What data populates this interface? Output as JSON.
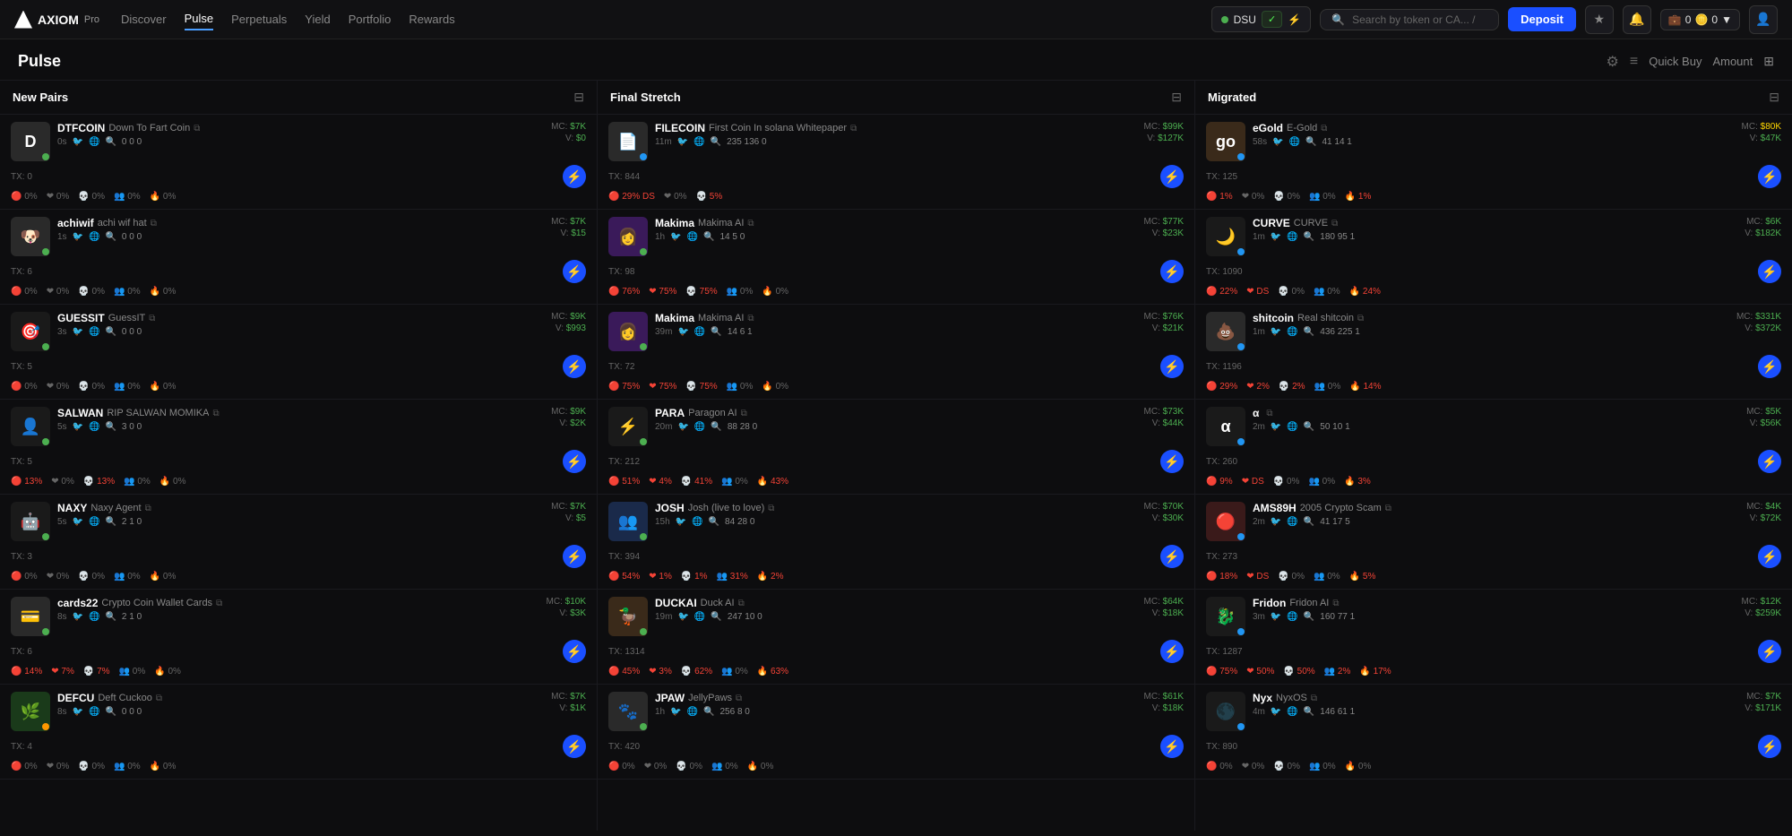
{
  "nav": {
    "logo": "AXIOM",
    "logo_sub": "Pro",
    "links": [
      "Discover",
      "Pulse",
      "Perpetuals",
      "Yield",
      "Portfolio",
      "Rewards"
    ],
    "active_link": "Pulse",
    "wallet": "DSU",
    "search_placeholder": "Search by token or CA... /",
    "deposit_label": "Deposit",
    "balance1": "0",
    "balance2": "0"
  },
  "page": {
    "title": "Pulse",
    "quick_buy": "Quick Buy",
    "amount": "Amount"
  },
  "columns": [
    {
      "id": "new-pairs",
      "title": "New Pairs",
      "cards": [
        {
          "symbol": "DTFCOIN",
          "name": "Down To Fart Coin",
          "bg": "D",
          "bg_color": "bg-gray",
          "age": "0s",
          "icon_links": true,
          "counts": "0 0 0",
          "mc": "$7K",
          "volume": "$0",
          "tx": "0",
          "pcts": [
            "0%",
            "0%",
            "0%",
            "0%",
            "0%"
          ],
          "status": "green"
        },
        {
          "symbol": "achiwif",
          "name": "achi wif hat",
          "bg": "🐶",
          "bg_color": "bg-gray",
          "age": "1s",
          "counts": "0 0 0",
          "mc": "$7K",
          "volume": "$15",
          "tx": "6",
          "pcts": [
            "0%",
            "0%",
            "0%",
            "0%",
            "0%"
          ],
          "status": "green"
        },
        {
          "symbol": "GUESSIT",
          "name": "GuessIT",
          "bg": "🎯",
          "bg_color": "bg-dark",
          "age": "3s",
          "counts": "0 0 0",
          "mc": "$9K",
          "volume": "$993",
          "tx": "5",
          "pcts": [
            "0%",
            "0%",
            "0%",
            "0%",
            "0%"
          ],
          "status": "green"
        },
        {
          "symbol": "SALWAN",
          "name": "RIP SALWAN MOMIKA",
          "bg": "👤",
          "bg_color": "bg-dark",
          "age": "5s",
          "counts": "3 0 0",
          "mc": "$9K",
          "volume": "$2K",
          "tx": "5",
          "pcts": [
            "13%",
            "0%",
            "13%",
            "0%",
            "0%"
          ],
          "status": "green"
        },
        {
          "symbol": "NAXY",
          "name": "Naxy Agent",
          "bg": "🤖",
          "bg_color": "bg-dark",
          "age": "5s",
          "counts": "2 1 0",
          "mc": "$7K",
          "volume": "$5",
          "tx": "3",
          "pcts": [
            "0%",
            "0%",
            "0%",
            "0%",
            "0%"
          ],
          "status": "green"
        },
        {
          "symbol": "cards22",
          "name": "Crypto Coin Wallet Cards",
          "bg": "💳",
          "bg_color": "bg-gray",
          "age": "8s",
          "counts": "2 1 0",
          "mc": "$10K",
          "volume": "$3K",
          "tx": "6",
          "pcts": [
            "14%",
            "7%",
            "7%",
            "0%",
            "0%"
          ],
          "status": "green"
        },
        {
          "symbol": "DEFCU",
          "name": "Deft Cuckoo",
          "bg": "🌿",
          "bg_color": "bg-green",
          "age": "8s",
          "counts": "0 0 0",
          "mc": "$7K",
          "volume": "$1K",
          "tx": "4",
          "pcts": [
            "0%",
            "0%",
            "0%",
            "0%",
            "0%"
          ],
          "status": "orange"
        }
      ]
    },
    {
      "id": "final-stretch",
      "title": "Final Stretch",
      "cards": [
        {
          "symbol": "FILECOIN",
          "name": "First Coin In solana Whitepaper",
          "bg": "📄",
          "bg_color": "bg-gray",
          "age": "11m",
          "counts": "235 136 0",
          "mc": "$99K",
          "volume": "$127K",
          "tx": "844",
          "pcts": [
            "29% DS",
            "0%",
            "5%"
          ],
          "has_ds": true,
          "status": "blue"
        },
        {
          "symbol": "Makima",
          "name": "Makima AI",
          "bg": "👩",
          "bg_color": "bg-purple",
          "age": "1h",
          "counts": "14 5 0",
          "mc": "$77K",
          "volume": "$23K",
          "tx": "98",
          "pcts": [
            "76%",
            "75%",
            "75%",
            "0%",
            "0%"
          ],
          "status": "green"
        },
        {
          "symbol": "Makima",
          "name": "Makima AI",
          "bg": "👩",
          "bg_color": "bg-purple",
          "age": "39m",
          "counts": "14 6 1",
          "mc": "$76K",
          "volume": "$21K",
          "tx": "72",
          "pcts": [
            "75%",
            "75%",
            "75%",
            "0%",
            "0%"
          ],
          "status": "green"
        },
        {
          "symbol": "PARA",
          "name": "Paragon AI",
          "bg": "⚡",
          "bg_color": "bg-dark",
          "age": "20m",
          "counts": "88 28 0",
          "mc": "$73K",
          "volume": "$44K",
          "tx": "212",
          "pcts": [
            "51%",
            "4%",
            "41%",
            "0%",
            "43%"
          ],
          "status": "green"
        },
        {
          "symbol": "JOSH",
          "name": "Josh (live to love)",
          "bg": "👥",
          "bg_color": "bg-blue",
          "age": "15h",
          "counts": "84 28 0",
          "mc": "$70K",
          "volume": "$30K",
          "tx": "394",
          "pcts": [
            "54%",
            "1%",
            "1%",
            "31%",
            "2%"
          ],
          "status": "green"
        },
        {
          "symbol": "DUCKAI",
          "name": "Duck AI",
          "bg": "🦆",
          "bg_color": "bg-orange",
          "age": "19m",
          "counts": "247 10 0",
          "mc": "$64K",
          "volume": "$18K",
          "tx": "1314",
          "pcts": [
            "45%",
            "3%",
            "62%",
            "0%",
            "63%"
          ],
          "status": "green"
        },
        {
          "symbol": "JPAW",
          "name": "JellyPaws",
          "bg": "🐾",
          "bg_color": "bg-gray",
          "age": "1h",
          "counts": "256 8 0",
          "mc": "$61K",
          "volume": "$18K",
          "tx": "420",
          "pcts": [
            "0%",
            "0%",
            "0%",
            "0%",
            "0%"
          ],
          "status": "green"
        }
      ]
    },
    {
      "id": "migrated",
      "title": "Migrated",
      "cards": [
        {
          "symbol": "eGold",
          "name": "E-Gold",
          "bg": "go",
          "bg_color": "bg-orange",
          "age": "58s",
          "counts": "41 14 1",
          "mc": "$80K",
          "mc_color": "mc-yellow",
          "volume": "$47K",
          "tx": "125",
          "pcts": [
            "1%",
            "0%",
            "0%",
            "0%",
            "1%"
          ],
          "status": "blue"
        },
        {
          "symbol": "CURVE",
          "name": "CURVE",
          "bg": "🌙",
          "bg_color": "bg-dark",
          "age": "1m",
          "counts": "180 95 1",
          "mc": "$6K",
          "volume": "$182K",
          "tx": "1090",
          "pcts": [
            "22%",
            "DS",
            "0%",
            "0%",
            "24%"
          ],
          "status": "blue"
        },
        {
          "symbol": "shitcoin",
          "name": "Real shitcoin",
          "bg": "💩",
          "bg_color": "bg-gray",
          "age": "1m",
          "counts": "436 225 1",
          "mc": "$331K",
          "volume": "$372K",
          "tx": "1196",
          "pcts": [
            "29%",
            "2%",
            "2%",
            "0%",
            "14%"
          ],
          "status": "blue"
        },
        {
          "symbol": "α",
          "name": "",
          "bg": "α",
          "bg_color": "bg-dark",
          "age": "2m",
          "counts": "50 10 1",
          "mc": "$5K",
          "volume": "$56K",
          "tx": "260",
          "pcts": [
            "9%",
            "DS",
            "0%",
            "0%",
            "3%"
          ],
          "status": "blue"
        },
        {
          "symbol": "AMS89H",
          "name": "2005 Crypto Scam",
          "bg": "🔴",
          "bg_color": "bg-red",
          "age": "2m",
          "counts": "41 17 5",
          "mc": "$4K",
          "volume": "$72K",
          "tx": "273",
          "pcts": [
            "18%",
            "DS",
            "0%",
            "0%",
            "5%"
          ],
          "status": "blue"
        },
        {
          "symbol": "Fridon",
          "name": "Fridon AI",
          "bg": "🐉",
          "bg_color": "bg-dark",
          "age": "3m",
          "counts": "160 77 1",
          "mc": "$12K",
          "volume": "$259K",
          "tx": "1287",
          "pcts": [
            "75%",
            "50%",
            "50%",
            "2%",
            "17%"
          ],
          "status": "blue"
        },
        {
          "symbol": "Nyx",
          "name": "NyxOS",
          "bg": "🌑",
          "bg_color": "bg-dark",
          "age": "4m",
          "counts": "146 61 1",
          "mc": "$7K",
          "volume": "$171K",
          "tx": "890",
          "pcts": [
            "0%",
            "0%",
            "0%",
            "0%",
            "0%"
          ],
          "status": "blue"
        }
      ]
    }
  ]
}
